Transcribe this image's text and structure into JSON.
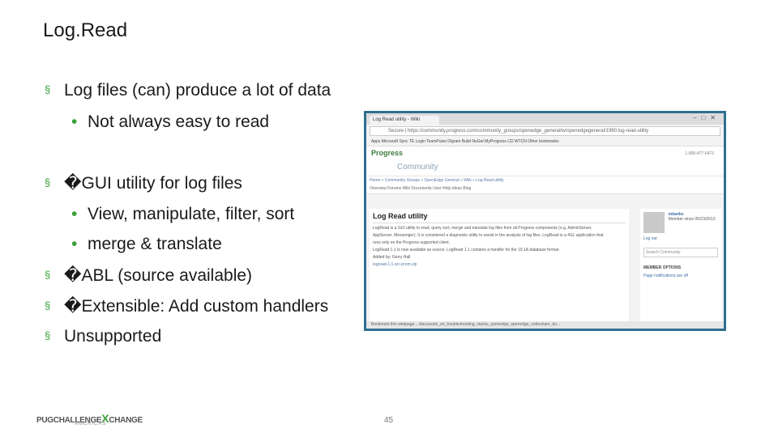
{
  "slide": {
    "title": "Log.Read",
    "bullets": [
      {
        "level": 1,
        "marker": "§",
        "text": "Log files (can) produce a lot of data"
      },
      {
        "level": 2,
        "marker": "•",
        "text": "Not always easy to read"
      },
      {
        "level": 1,
        "marker": "§",
        "text": "�GUI utility for log files"
      },
      {
        "level": 2,
        "marker": "•",
        "text": "View, manipulate, filter, sort"
      },
      {
        "level": 2,
        "marker": "•",
        "text": "merge & translate"
      },
      {
        "level": 1,
        "marker": "§",
        "text": "�ABL (source available)"
      },
      {
        "level": 1,
        "marker": "§",
        "text": "�Extensible: Add custom handlers"
      },
      {
        "level": 1,
        "marker": "§",
        "text": "Unsupported"
      }
    ],
    "page_number": "45",
    "footer": {
      "logo": "PUGCHALLENGE",
      "logo_x": "X",
      "logo_tail": "CHANGE",
      "sub": "AMERICAS"
    }
  },
  "screenshot": {
    "tab": "Log Read utility - Wiki",
    "address": "Secure | https://community.progress.com/community_groups/openedge_general/w/openedgegeneral/1990.log-read-utility",
    "bookmarks": "Apps   Microsoft Sync   TE   Login   TeamPulse   Digram   Build NuGet   MyProgress   CD   WTCN   Other bookmarks",
    "brand": "Progress",
    "community": "Community",
    "phone": "1-800-477-6473",
    "breadcrumb": "Home » Community Groups » OpenEdge General » Wiki » Log Read utility",
    "navtabs": "Overview   Forums   Wiki   Documents   User Help   Ideas   Blog",
    "content_title": "Log Read utility",
    "content_lines": [
      "LogRead is a GUI utility to read, query sort, merge and translate log files from all Progress components (e.g. AdminServer,",
      "AppServer, Messenger). It is considered a diagnostic utility to assist in the analysis of log files. LogRead is a 4GL application that",
      "runs only on the Progress supported client.",
      "LogRead 1.1 is now available as source. LogRead 1.1 contains a handler for the 10.1A database format.",
      "Added by: Gerry Hall",
      "logread-1.1-src-prom.zip"
    ],
    "user": "mbanks",
    "member_since": "Member since 05/23/2013",
    "logout": "Log out",
    "search_placeholder": "Search Community",
    "member_options": "MEMBER OPTIONS",
    "notifications": "Page notifications are off",
    "status": "Bookmark this webpage   ...discussion_on_troubleshooting_stacks_openedge_openedge_codeshare_do..."
  }
}
